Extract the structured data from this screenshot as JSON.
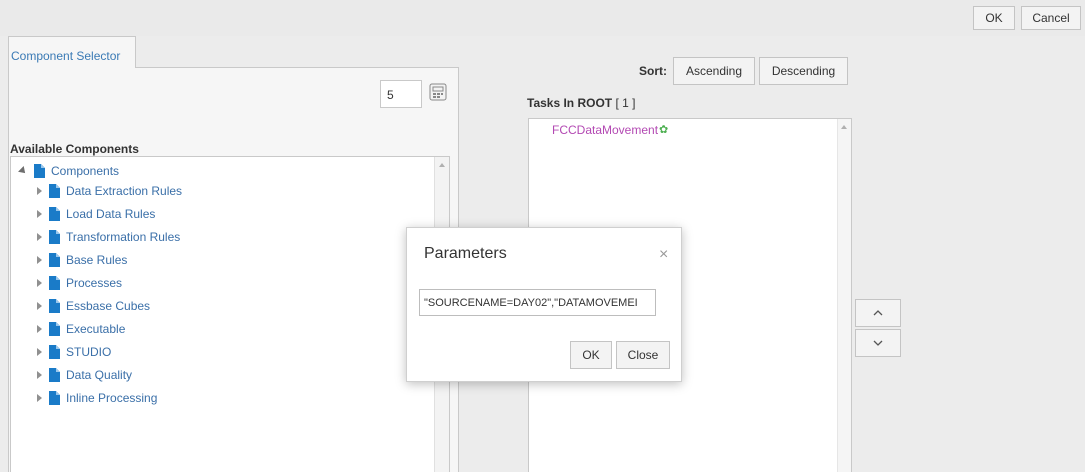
{
  "toolbar": {
    "ok_label": "OK",
    "cancel_label": "Cancel"
  },
  "tab": {
    "label": "Component Selector"
  },
  "left": {
    "count_value": "5",
    "available_title": "Available Components",
    "tree": {
      "root_label": "Components",
      "items": [
        {
          "label": "Data Extraction Rules"
        },
        {
          "label": "Load Data Rules"
        },
        {
          "label": "Transformation Rules"
        },
        {
          "label": "Base Rules"
        },
        {
          "label": "Processes"
        },
        {
          "label": "Essbase Cubes"
        },
        {
          "label": "Executable"
        },
        {
          "label": "STUDIO"
        },
        {
          "label": "Data Quality"
        },
        {
          "label": "Inline Processing"
        }
      ]
    }
  },
  "sort": {
    "label": "Sort:",
    "ascending": "Ascending",
    "descending": "Descending"
  },
  "tasks": {
    "title": "Tasks In ROOT",
    "count": "[ 1 ]",
    "items": [
      {
        "label": "FCCDataMovement"
      }
    ]
  },
  "dialog": {
    "title": "Parameters",
    "close_glyph": "×",
    "input_value": "\"SOURCENAME=DAY02\",\"DATAMOVEMEI",
    "ok_label": "OK",
    "close_label": "Close"
  },
  "colors": {
    "link_blue": "#3a6fa8",
    "task_purple": "#b349b3",
    "gear_green": "#4caf50",
    "file_icon_blue": "#1a7bc8"
  }
}
